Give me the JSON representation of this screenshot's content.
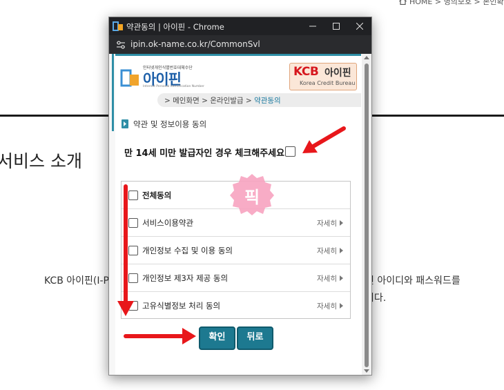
{
  "background": {
    "breadcrumb": "HOME  >  명의보호  >  본인확",
    "heading": "서비스 소개",
    "text_left": "KCB 아이핀(I-PI",
    "text_right_1": "핀 아이디와 패스워드를",
    "text_right_2": "니다."
  },
  "window": {
    "title": "약관동의 | 아이핀 - Chrome",
    "url": "ipin.ok-name.co.kr/CommonSvl",
    "minimize_icon": "minimize-icon",
    "maximize_icon": "maximize-icon",
    "close_icon": "close-icon"
  },
  "header": {
    "logo_tagline": "인터넷개인식별번호대체수단",
    "logo_brand": "아이핀",
    "logo_sub": "Internet Personal Identification Number",
    "kcb_brand": "KCB",
    "kcb_ipin": "아이핀",
    "kcb_sub": "Korea Credit Bureau"
  },
  "breadcrumb": {
    "items": [
      "메인화면",
      "온라인발급"
    ],
    "current": "약관동의"
  },
  "section_title": "약관 및 정보이용 동의",
  "age_check_label": "만 14세 미만 발급자인 경우 체크해주세요.",
  "agreements": [
    {
      "label": "전체동의",
      "detail": ""
    },
    {
      "label": "서비스이용약관",
      "detail": "자세히"
    },
    {
      "label": "개인정보 수집 및 이용 동의",
      "detail": "자세히"
    },
    {
      "label": "개인정보 제3자 제공 동의",
      "detail": "자세히"
    },
    {
      "label": "고유식별정보 처리 동의",
      "detail": "자세히"
    }
  ],
  "buttons": {
    "confirm": "확인",
    "back": "뒤로"
  },
  "overlay": {
    "badge_text": "픽",
    "arrow_color": "#e8171b",
    "badge_color": "#f7a3c0"
  },
  "colors": {
    "accent": "#1d7990",
    "title_bar": "#202124"
  }
}
